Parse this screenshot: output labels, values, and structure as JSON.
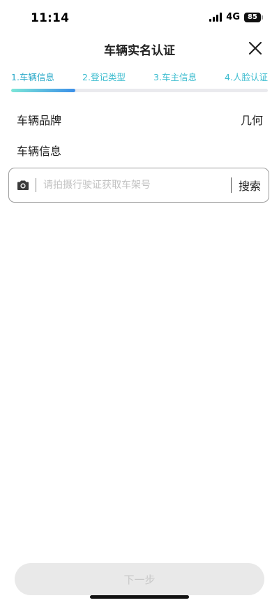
{
  "status_bar": {
    "time": "11:14",
    "network": "4G",
    "battery": "85"
  },
  "header": {
    "title": "车辆实名认证",
    "close_icon": "close-icon"
  },
  "steps": [
    {
      "label": "1.车辆信息"
    },
    {
      "label": "2.登记类型"
    },
    {
      "label": "3.车主信息"
    },
    {
      "label": "4.人脸认证"
    }
  ],
  "progress": {
    "current_step": 1,
    "total_steps": 4,
    "fraction": 0.25
  },
  "form": {
    "brand_label": "车辆品牌",
    "brand_value": "几何",
    "vehicle_info_label": "车辆信息",
    "search": {
      "placeholder": "请拍摄行驶证获取车架号",
      "value": "",
      "button_label": "搜索",
      "camera_icon": "camera-icon"
    }
  },
  "footer": {
    "next_label": "下一步"
  },
  "colors": {
    "accent": "#3bbccf",
    "progress_start": "#7de6d8",
    "progress_end": "#3b8fe8",
    "disabled_button": "#e9e9e9"
  }
}
